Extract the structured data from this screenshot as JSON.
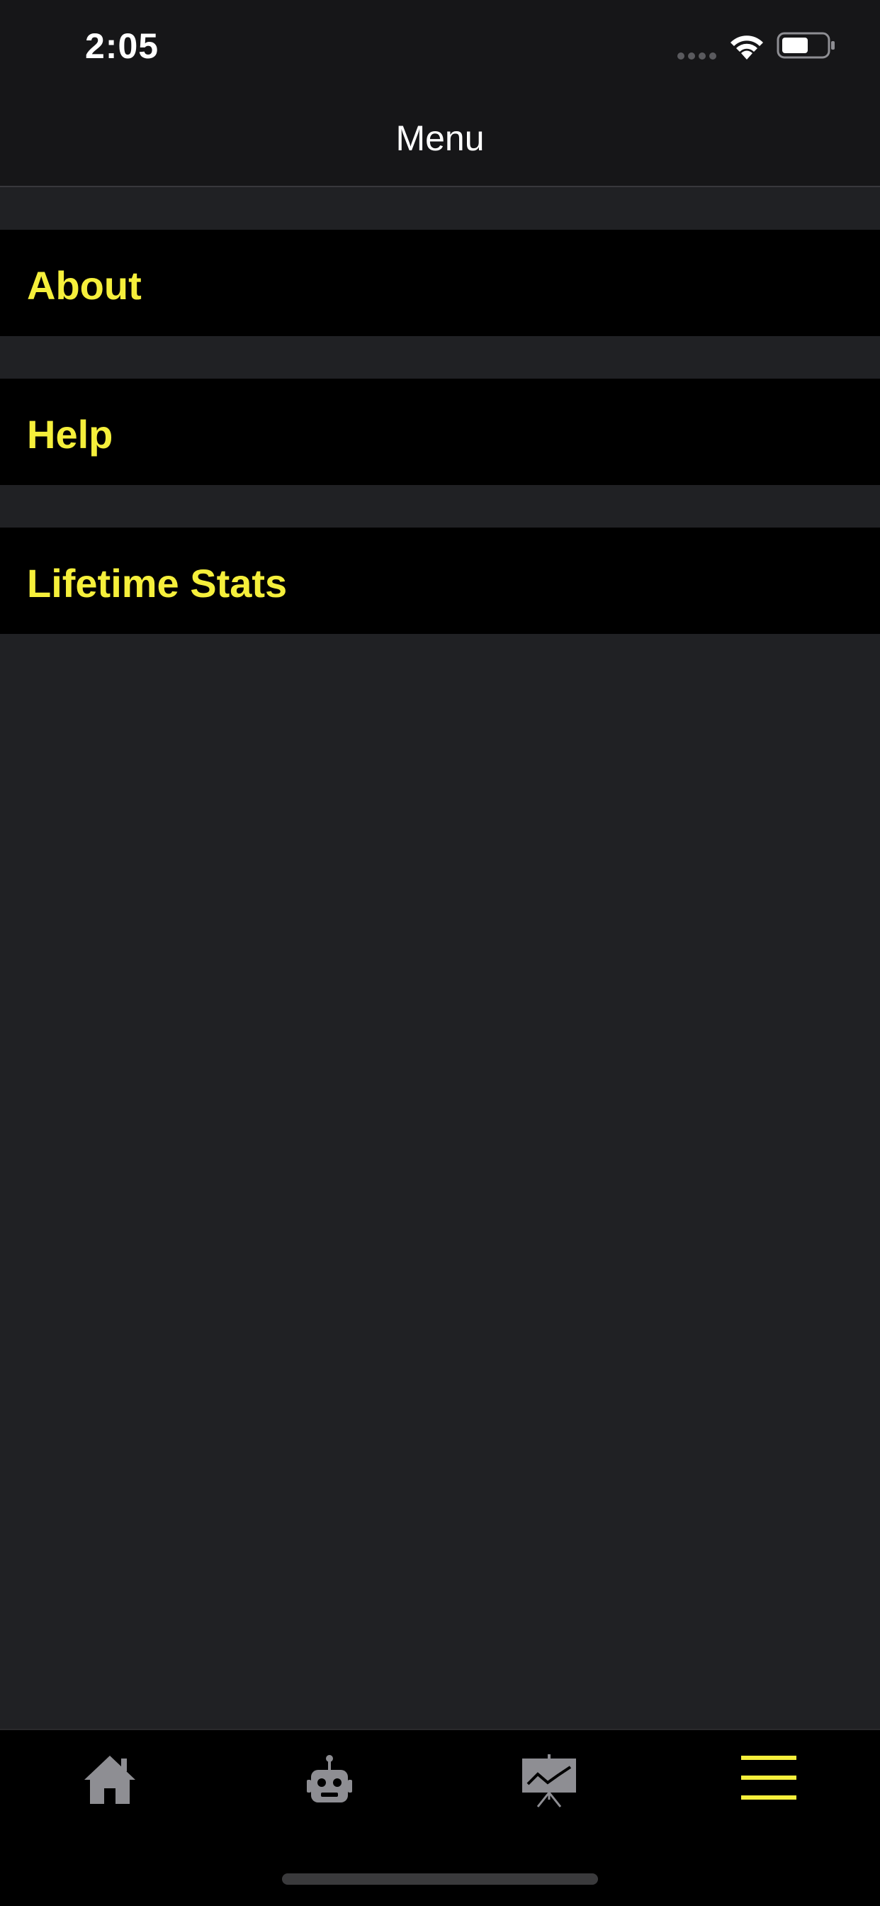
{
  "status_bar": {
    "time": "2:05"
  },
  "nav": {
    "title": "Menu"
  },
  "menu": {
    "items": [
      {
        "label": "About"
      },
      {
        "label": "Help"
      },
      {
        "label": "Lifetime Stats"
      }
    ]
  },
  "tab_bar": {
    "tabs": [
      {
        "icon": "home-icon",
        "selected": false
      },
      {
        "icon": "robot-icon",
        "selected": false
      },
      {
        "icon": "presentation-chart-icon",
        "selected": false
      },
      {
        "icon": "hamburger-menu-icon",
        "selected": true
      }
    ]
  },
  "colors": {
    "accent": "#f5ef3b",
    "background": "#202124",
    "row_background": "#000000",
    "inactive_icon": "#8e8e93"
  }
}
